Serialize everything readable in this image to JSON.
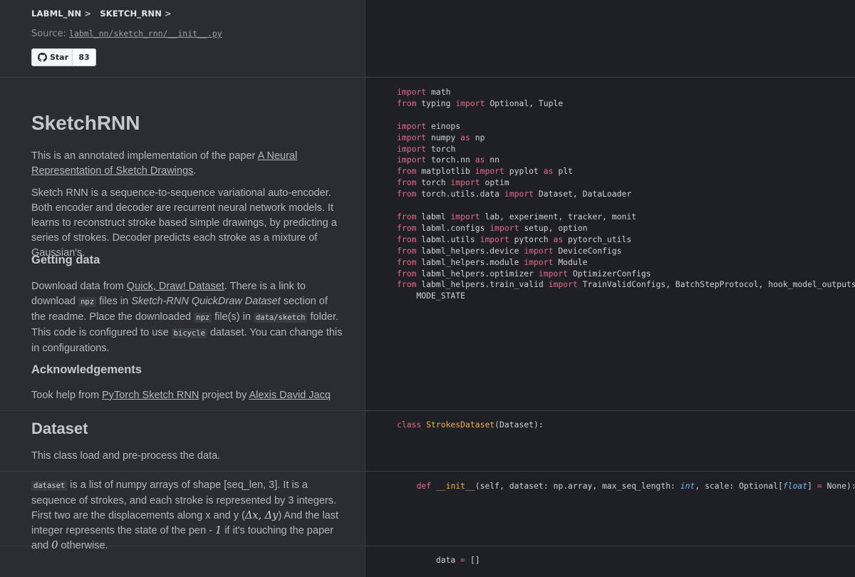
{
  "breadcrumb": {
    "item1": "LABML_NN",
    "item2": "SKETCH_RNN",
    "sep": ">"
  },
  "source": {
    "label": "Source:",
    "path": "labml_nn/sketch_rnn/__init__.py"
  },
  "star": {
    "label": "Star",
    "count": "83"
  },
  "intro": {
    "title": "SketchRNN",
    "p1_pre": "This is an annotated implementation of the paper ",
    "p1_link": "A Neural Representation of Sketch Drawings",
    "p1_post": ".",
    "p2": "Sketch RNN is a sequence-to-sequence variational auto-encoder. Both encoder and decoder are recurrent neural network models. It learns to reconstruct stroke based simple drawings, by predicting a series of strokes. Decoder predicts each stroke as a mixture of Gaussian's.",
    "h_getting": "Getting data",
    "p3_a": "Download data from ",
    "p3_link": "Quick, Draw! Dataset",
    "p3_b": ". There is a link to download ",
    "p3_code1": "npz",
    "p3_c": " files in ",
    "p3_em": "Sketch-RNN QuickDraw Dataset",
    "p3_d": " section of the readme. Place the downloaded ",
    "p3_code2": "npz",
    "p3_e": " file(s) in ",
    "p3_code3": "data/sketch",
    "p3_f": " folder. This code is configured to use ",
    "p3_code4": "bicycle",
    "p3_g": " dataset. You can change this in configurations.",
    "h_ack": "Acknowledgements",
    "p4_a": "Took help from ",
    "p4_link1": "PyTorch Sketch RNN",
    "p4_b": " project by ",
    "p4_link2": "Alexis David Jacq"
  },
  "dataset_section": {
    "title": "Dataset",
    "p": "This class load and pre-process the data."
  },
  "dataset_desc": {
    "code": "dataset",
    "a": " is a list of numpy arrays of shape [seq_len, 3]. It is a sequence of strokes, and each stroke is represented by 3 integers. First two are the displacements along x and y (",
    "math1": "Δx, Δy",
    "b": ") And the last integer represents the state of the pen - ",
    "math2": "1",
    "c": " if it's touching the paper and ",
    "math3": "0",
    "d": " otherwise."
  },
  "code_imports": [
    [
      [
        "kw",
        "import"
      ],
      [
        "t",
        " math"
      ]
    ],
    [
      [
        "kw",
        "from"
      ],
      [
        "t",
        " typing "
      ],
      [
        "kw",
        "import"
      ],
      [
        "t",
        " Optional, Tuple"
      ]
    ],
    [
      [
        "t",
        ""
      ]
    ],
    [
      [
        "kw",
        "import"
      ],
      [
        "t",
        " einops"
      ]
    ],
    [
      [
        "kw",
        "import"
      ],
      [
        "t",
        " numpy "
      ],
      [
        "kw",
        "as"
      ],
      [
        "t",
        " np"
      ]
    ],
    [
      [
        "kw",
        "import"
      ],
      [
        "t",
        " torch"
      ]
    ],
    [
      [
        "kw",
        "import"
      ],
      [
        "t",
        " torch.nn "
      ],
      [
        "kw",
        "as"
      ],
      [
        "t",
        " nn"
      ]
    ],
    [
      [
        "kw",
        "from"
      ],
      [
        "t",
        " matplotlib "
      ],
      [
        "kw",
        "import"
      ],
      [
        "t",
        " pyplot "
      ],
      [
        "kw",
        "as"
      ],
      [
        "t",
        " plt"
      ]
    ],
    [
      [
        "kw",
        "from"
      ],
      [
        "t",
        " torch "
      ],
      [
        "kw",
        "import"
      ],
      [
        "t",
        " optim"
      ]
    ],
    [
      [
        "kw",
        "from"
      ],
      [
        "t",
        " torch.utils.data "
      ],
      [
        "kw",
        "import"
      ],
      [
        "t",
        " Dataset, DataLoader"
      ]
    ],
    [
      [
        "t",
        ""
      ]
    ],
    [
      [
        "kw",
        "from"
      ],
      [
        "t",
        " labml "
      ],
      [
        "kw",
        "import"
      ],
      [
        "t",
        " lab, experiment, tracker, monit"
      ]
    ],
    [
      [
        "kw",
        "from"
      ],
      [
        "t",
        " labml.configs "
      ],
      [
        "kw",
        "import"
      ],
      [
        "t",
        " setup, option"
      ]
    ],
    [
      [
        "kw",
        "from"
      ],
      [
        "t",
        " labml.utils "
      ],
      [
        "kw",
        "import"
      ],
      [
        "t",
        " pytorch "
      ],
      [
        "kw",
        "as"
      ],
      [
        "t",
        " pytorch_utils"
      ]
    ],
    [
      [
        "kw",
        "from"
      ],
      [
        "t",
        " labml_helpers.device "
      ],
      [
        "kw",
        "import"
      ],
      [
        "t",
        " DeviceConfigs"
      ]
    ],
    [
      [
        "kw",
        "from"
      ],
      [
        "t",
        " labml_helpers.module "
      ],
      [
        "kw",
        "import"
      ],
      [
        "t",
        " Module"
      ]
    ],
    [
      [
        "kw",
        "from"
      ],
      [
        "t",
        " labml_helpers.optimizer "
      ],
      [
        "kw",
        "import"
      ],
      [
        "t",
        " OptimizerConfigs"
      ]
    ],
    [
      [
        "kw",
        "from"
      ],
      [
        "t",
        " labml_helpers.train_valid "
      ],
      [
        "kw",
        "import"
      ],
      [
        "t",
        " TrainValidConfigs, BatchStepProtocol, hook_model_outputs, \\"
      ]
    ],
    [
      [
        "t",
        "    MODE_STATE"
      ]
    ]
  ],
  "code_class": [
    [
      [
        "kw",
        "class"
      ],
      [
        "t",
        " "
      ],
      [
        "cls",
        "StrokesDataset"
      ],
      [
        "t",
        "(Dataset):"
      ]
    ]
  ],
  "code_init": [
    [
      [
        "t",
        "    "
      ],
      [
        "kw",
        "def"
      ],
      [
        "t",
        " "
      ],
      [
        "fn",
        "__init__"
      ],
      [
        "t",
        "(self, dataset: np.array, max_seq_length: "
      ],
      [
        "ty",
        "int"
      ],
      [
        "t",
        ", scale: Optional["
      ],
      [
        "ty",
        "float"
      ],
      [
        "t",
        "] "
      ],
      [
        "op",
        "="
      ],
      [
        "t",
        " None):"
      ]
    ]
  ],
  "code_data": [
    [
      [
        "t",
        "        data "
      ],
      [
        "op",
        "="
      ],
      [
        "t",
        " []"
      ]
    ]
  ]
}
